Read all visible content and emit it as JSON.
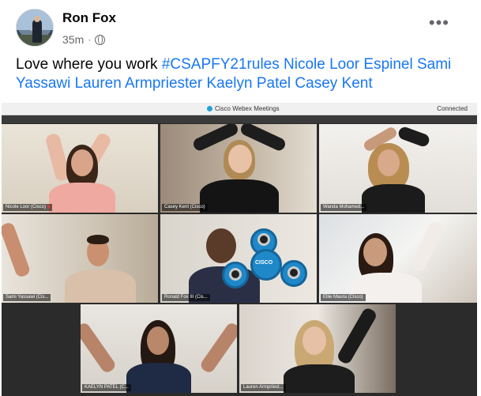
{
  "post": {
    "author": "Ron Fox",
    "time": "35m",
    "separator": "·",
    "more_label": "•••",
    "text_prefix": "Love where you work",
    "hashtag": "#CSAPFY21rules",
    "tagged_line_1": "Nicole Loor Espinel Sami",
    "tagged_line_2": "Yassawi Lauren Armpriester Kaelyn Patel Casey Kent",
    "audience_icon": "globe-icon"
  },
  "meeting": {
    "app_title": "Cisco Webex Meetings",
    "status": "Connected",
    "participants": [
      {
        "name": "Nicole Loor (Cisco)"
      },
      {
        "name": "Casey Kent (Cisco)"
      },
      {
        "name": "Wanda Mohamed..."
      },
      {
        "name": "Sami Yassawi (Cis..."
      },
      {
        "name": "Ronald Fox III (Cis..."
      },
      {
        "name": "Ellie Maura (Cisco)"
      },
      {
        "name": "KAELYN PATEL (C..."
      },
      {
        "name": "Lauren Armpriest..."
      }
    ],
    "spinner_logo": "CISCO"
  }
}
